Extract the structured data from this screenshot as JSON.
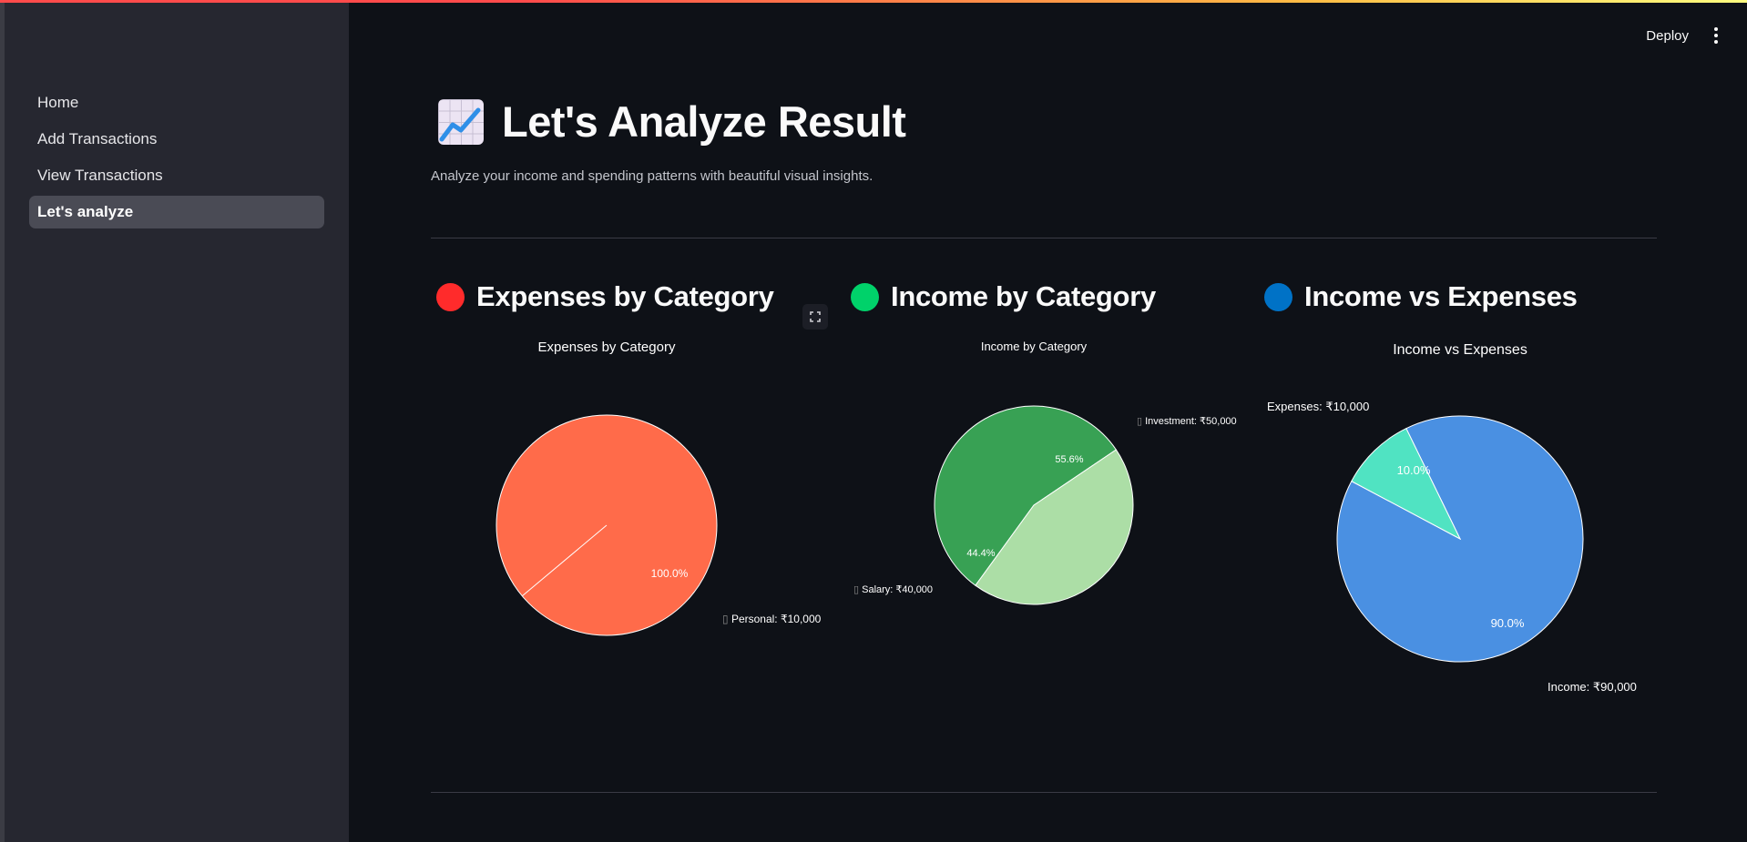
{
  "sidebar": {
    "items": [
      {
        "label": "Home",
        "active": false
      },
      {
        "label": "Add Transactions",
        "active": false
      },
      {
        "label": "View Transactions",
        "active": false
      },
      {
        "label": "Let's analyze",
        "active": true
      }
    ]
  },
  "header": {
    "deploy_label": "Deploy",
    "menu_icon": "more-vertical-icon"
  },
  "page": {
    "icon": "chart-increasing-icon",
    "title": "Let's Analyze Result",
    "subtitle": "Analyze your income and spending patterns with beautiful visual insights."
  },
  "sections": [
    {
      "title": "Expenses by Category",
      "dot_color": "#ff2b2b"
    },
    {
      "title": "Income by Category",
      "dot_color": "#00d26a"
    },
    {
      "title": "Income vs Expenses",
      "dot_color": "#0072c6"
    }
  ],
  "chart_data": [
    {
      "type": "pie",
      "title": "Expenses by Category",
      "slices": [
        {
          "label": "Personal: ₹10,000",
          "value": 10000,
          "percent_label": "100.0%",
          "color": "#ff6b4a"
        }
      ]
    },
    {
      "type": "pie",
      "title": "Income by Category",
      "slices": [
        {
          "label": "Investment: ₹50,000",
          "value": 50000,
          "percent_label": "55.6%",
          "color": "#38a154"
        },
        {
          "label": "Salary: ₹40,000",
          "value": 40000,
          "percent_label": "44.4%",
          "color": "#acdea6"
        }
      ]
    },
    {
      "type": "pie",
      "title": "Income vs Expenses",
      "slices": [
        {
          "label": "Income: ₹90,000",
          "value": 90000,
          "percent_label": "90.0%",
          "color": "#4a90e2"
        },
        {
          "label": "Expenses: ₹10,000",
          "value": 10000,
          "percent_label": "10.0%",
          "color": "#50e3c2"
        }
      ]
    }
  ]
}
